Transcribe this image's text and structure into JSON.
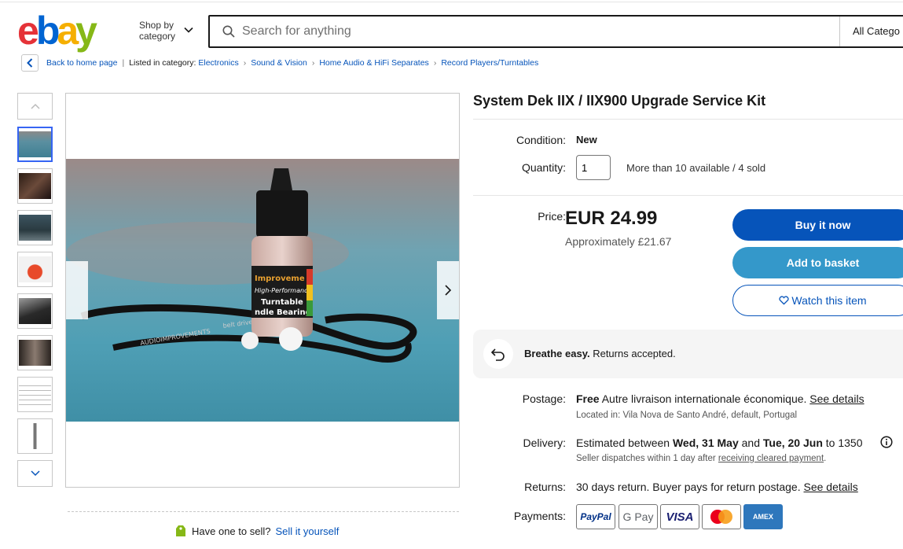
{
  "header": {
    "shop_by": [
      "Shop by",
      "category"
    ],
    "search_placeholder": "Search for anything",
    "category_select": "All Catego"
  },
  "breadcrumb": {
    "back": "Back to home page",
    "listed_in": "Listed in category:",
    "items": [
      "Electronics",
      "Sound & Vision",
      "Home Audio & HiFi Separates",
      "Record Players/Turntables"
    ]
  },
  "gallery": {
    "thumb_count": 8,
    "selected_index": 0,
    "photo_labels": [
      "Improveme",
      "High-Performance",
      "Turntable",
      "ndle Bearing",
      "AUDIOIMPROVEMENTS",
      "belt drive"
    ]
  },
  "item": {
    "title": "System Dek IIX / IIX900 Upgrade Service Kit",
    "condition_label": "Condition:",
    "condition_value": "New",
    "quantity_label": "Quantity:",
    "quantity_value": "1",
    "availability": "More than 10 available / 4 sold",
    "price_label": "Price:",
    "price": "EUR 24.99",
    "approx": "Approximately £21.67",
    "buy_now": "Buy it now",
    "add_to_basket": "Add to basket",
    "watch": "Watch this item"
  },
  "returns_banner": {
    "bold": "Breathe easy.",
    "text": " Returns accepted."
  },
  "postage": {
    "label": "Postage:",
    "free": "Free",
    "text": " Autre livraison internationale économique. ",
    "see_details": "See details",
    "location": "Located in: Vila Nova de Santo André, default, Portugal"
  },
  "delivery": {
    "label": "Delivery:",
    "pre": "Estimated between ",
    "date1": "Wed, 31 May",
    "mid": " and ",
    "date2": "Tue, 20 Jun",
    "post": " to 1350",
    "dispatch_pre": "Seller dispatches within 1 day after ",
    "dispatch_link": "receiving cleared payment",
    "dispatch_post": "."
  },
  "returns": {
    "label": "Returns:",
    "text": "30 days return. Buyer pays for return postage. ",
    "see_details": "See details"
  },
  "payments": {
    "label": "Payments:",
    "methods": [
      "PayPal",
      "G Pay",
      "VISA",
      "Mastercard",
      "AMEX"
    ]
  },
  "sell": {
    "prompt": "Have one to sell?",
    "link": "Sell it yourself"
  },
  "colors": {
    "link": "#0654ba",
    "buy": "#0654ba",
    "basket": "#3498ca"
  }
}
